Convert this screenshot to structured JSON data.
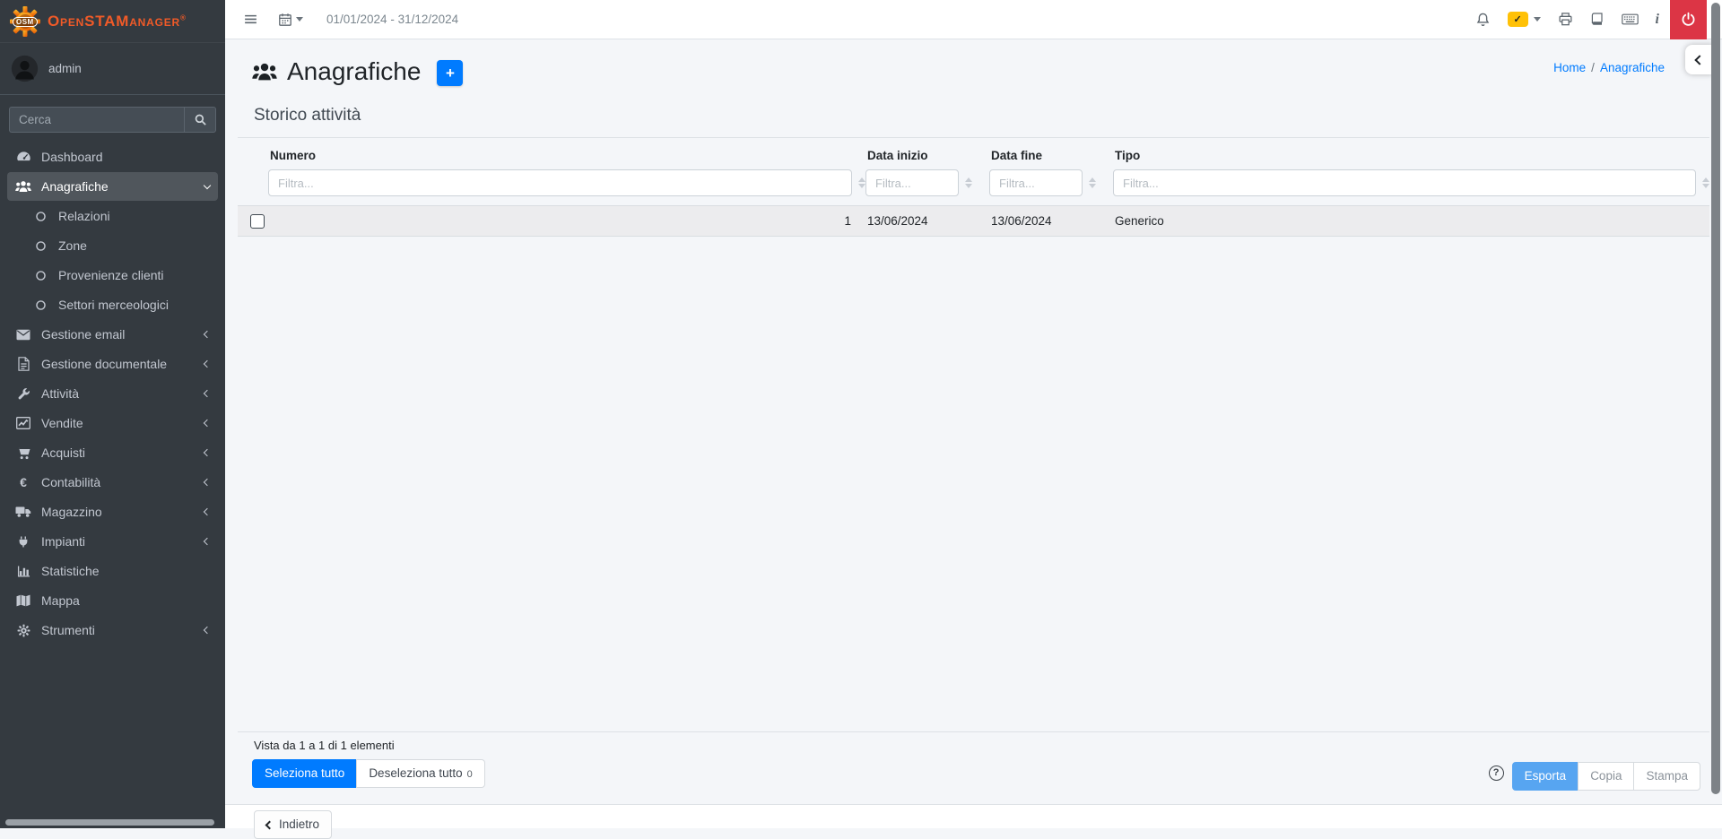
{
  "app": {
    "logo_text": "OSM",
    "name": "OpenSTAManager",
    "reg": "®"
  },
  "user": {
    "name": "admin"
  },
  "topbar": {
    "date_range": "01/01/2024 - 31/12/2024"
  },
  "icons": {
    "check": "✓",
    "info": "i",
    "euro": "€",
    "plus": "+",
    "question": "?"
  },
  "sidebar": {
    "search_placeholder": "Cerca",
    "items": [
      {
        "label": "Dashboard"
      },
      {
        "label": "Anagrafiche"
      },
      {
        "label": "Relazioni"
      },
      {
        "label": "Zone"
      },
      {
        "label": "Provenienze clienti"
      },
      {
        "label": "Settori merceologici"
      },
      {
        "label": "Gestione email"
      },
      {
        "label": "Gestione documentale"
      },
      {
        "label": "Attività"
      },
      {
        "label": "Vendite"
      },
      {
        "label": "Acquisti"
      },
      {
        "label": "Contabilità"
      },
      {
        "label": "Magazzino"
      },
      {
        "label": "Impianti"
      },
      {
        "label": "Statistiche"
      },
      {
        "label": "Mappa"
      },
      {
        "label": "Strumenti"
      }
    ]
  },
  "page": {
    "title": "Anagrafiche",
    "section_title": "Storico attività",
    "breadcrumb": {
      "home": "Home",
      "sep": "/",
      "current": "Anagrafiche"
    }
  },
  "table": {
    "columns": {
      "numero": "Numero",
      "data_inizio": "Data inizio",
      "data_fine": "Data fine",
      "tipo": "Tipo"
    },
    "filter_placeholder": "Filtra...",
    "rows": [
      {
        "numero": "1",
        "data_inizio": "13/06/2024",
        "data_fine": "13/06/2024",
        "tipo": "Generico"
      }
    ]
  },
  "footer": {
    "summary": "Vista da 1 a 1 di 1 elementi",
    "select_all": "Seleziona tutto",
    "deselect_all": "Deseleziona tutto",
    "deselect_count": "0",
    "export": "Esporta",
    "copy": "Copia",
    "print": "Stampa",
    "back": "Indietro"
  },
  "colors": {
    "accent": "#007bff",
    "danger": "#dc3545",
    "warning": "#ffc107",
    "sidebar_bg": "#343a40",
    "export_blue": "#57a5f1",
    "logo_orange": "#f05a28"
  }
}
